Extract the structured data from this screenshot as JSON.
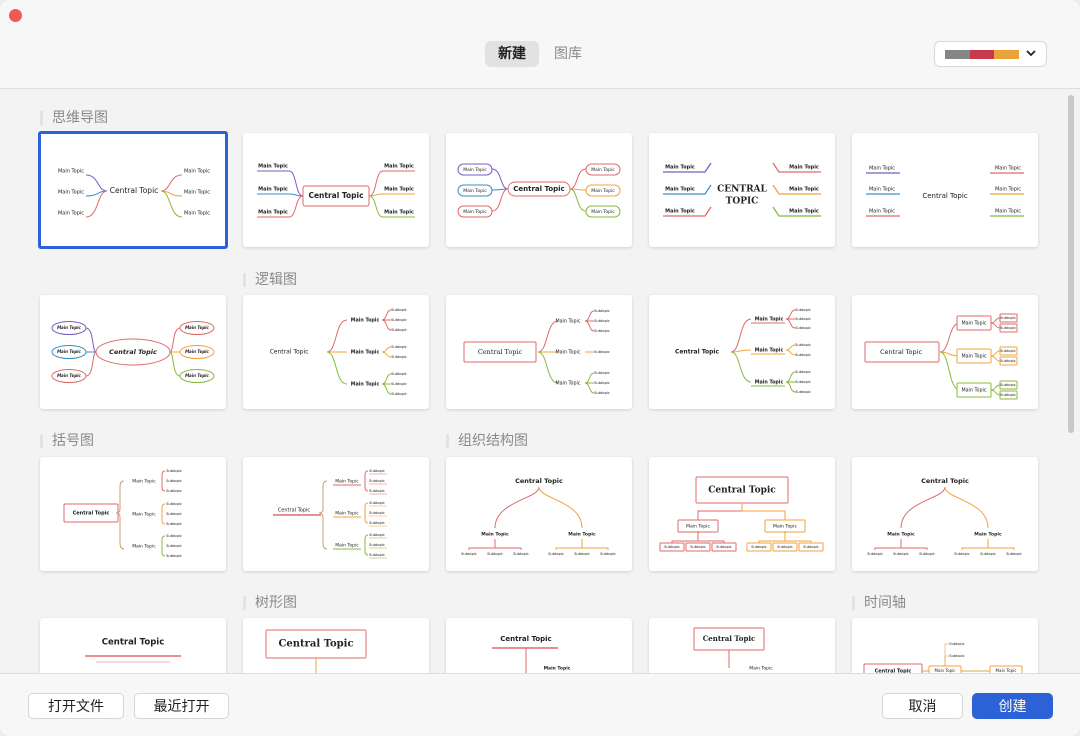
{
  "header": {
    "tabs": [
      {
        "label": "新建",
        "active": true
      },
      {
        "label": "图库",
        "active": false
      }
    ],
    "theme_swatches": [
      "#858585",
      "#c83a4b",
      "#e8a33b"
    ]
  },
  "sections": {
    "mind_map": "思维导图",
    "logic": "逻辑图",
    "bracket": "括号图",
    "org": "组织结构图",
    "tree": "树形图",
    "timeline": "时间轴"
  },
  "node_text": {
    "central": "Central Topic",
    "central_caps": "CENTRAL TOPIC",
    "central_caps_1": "CENTRAL",
    "central_caps_2": "TOPIC",
    "main": "Main Topic",
    "sub": "Subtopic"
  },
  "colors": {
    "selection": "#2d62d6",
    "primary": "#2d62d6",
    "branch_red": "#e06a6a",
    "branch_orange": "#f0a33b",
    "branch_purple": "#7b5cc4",
    "branch_blue": "#3a8ec9",
    "branch_green": "#8ab83a"
  },
  "footer": {
    "open_file": "打开文件",
    "recent": "最近打开",
    "cancel": "取消",
    "create": "创建"
  }
}
